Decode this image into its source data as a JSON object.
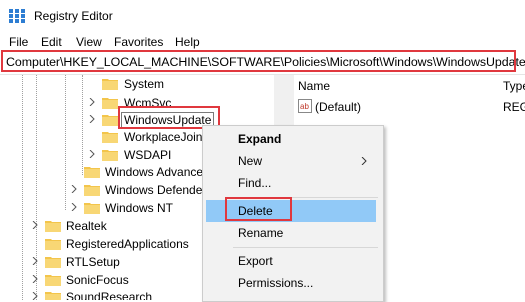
{
  "window": {
    "title": "Registry Editor"
  },
  "menubar": {
    "items": [
      "File",
      "Edit",
      "View",
      "Favorites",
      "Help"
    ]
  },
  "address": {
    "path": "Computer\\HKEY_LOCAL_MACHINE\\SOFTWARE\\Policies\\Microsoft\\Windows\\WindowsUpdate"
  },
  "tree": {
    "items": [
      {
        "label": "System",
        "expandable": false
      },
      {
        "label": "WcmSvc",
        "expandable": true
      },
      {
        "label": "WindowsUpdate",
        "expandable": true,
        "selected": true
      },
      {
        "label": "WorkplaceJoin",
        "expandable": false
      },
      {
        "label": "WSDAPI",
        "expandable": true
      },
      {
        "label": "Windows Advance",
        "expandable": false
      },
      {
        "label": "Windows Defender",
        "expandable": true
      },
      {
        "label": "Windows NT",
        "expandable": true
      },
      {
        "label": "Realtek",
        "expandable": true
      },
      {
        "label": "RegisteredApplications",
        "expandable": false
      },
      {
        "label": "RTLSetup",
        "expandable": true
      },
      {
        "label": "SonicFocus",
        "expandable": true
      },
      {
        "label": "SoundResearch",
        "expandable": true
      }
    ]
  },
  "list": {
    "columns": [
      "Name",
      "Type"
    ],
    "rows": [
      {
        "name": "(Default)",
        "type": "REG_"
      }
    ]
  },
  "context_menu": {
    "items": [
      {
        "label": "Expand",
        "bold": true
      },
      {
        "label": "New",
        "submenu": true
      },
      {
        "label": "Find..."
      },
      {
        "label": "Delete",
        "hover": true
      },
      {
        "label": "Rename"
      },
      {
        "label": "Export"
      },
      {
        "label": "Permissions..."
      }
    ]
  },
  "colors": {
    "highlight_box": "#e0383e",
    "menu_hover": "#91c9f7",
    "folder": "#f3c54b"
  }
}
